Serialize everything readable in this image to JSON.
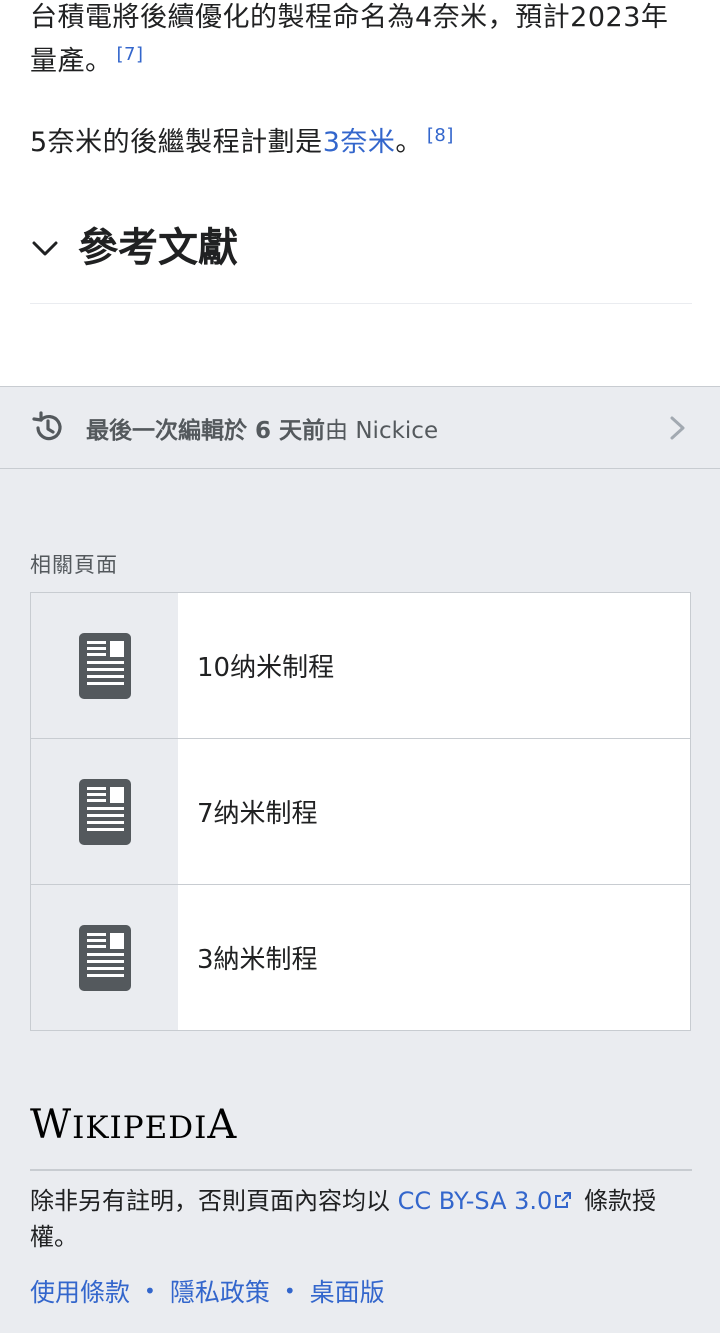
{
  "article": {
    "para1_text": "台積電將後續優化的製程命名為4奈米，預計2023年量產。",
    "para1_ref": "[7]",
    "para2_prefix": "5奈米的後繼製程計劃是",
    "para2_link": "3奈米",
    "para2_suffix": "。",
    "para2_ref": "[8]"
  },
  "section": {
    "title": "參考文獻",
    "icon": "chevron-down-icon"
  },
  "last_modified": {
    "bold_text": "最後一次編輯於 6 天前",
    "by_text": "由 Nickice",
    "icon": "history-icon"
  },
  "related": {
    "heading": "相關頁面",
    "items": [
      {
        "title": "10纳米制程"
      },
      {
        "title": "7纳米制程"
      },
      {
        "title": "3納米制程"
      }
    ]
  },
  "footer": {
    "wordmark_W": "W",
    "wordmark_rest": "IKIPEDI",
    "wordmark_A": "A",
    "license_prefix": "除非另有註明，否則頁面內容均以 ",
    "license_link": "CC BY-SA 3.0",
    "license_suffix": " 條款授權。",
    "links": [
      "使用條款",
      "隱私政策",
      "桌面版"
    ],
    "separator": "•"
  },
  "colors": {
    "link": "#3366cc",
    "text": "#202122",
    "subtle": "#54595d",
    "footer_bg": "#eaecf0",
    "border": "#c8ccd1"
  }
}
